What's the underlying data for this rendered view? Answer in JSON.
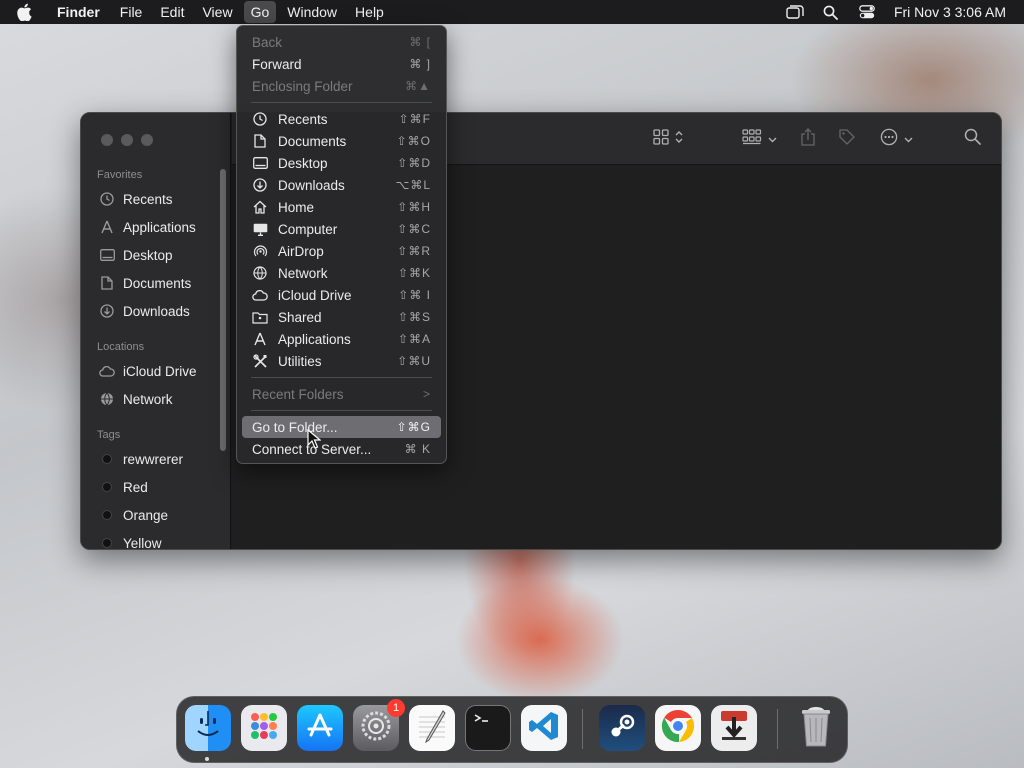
{
  "menubar": {
    "app_name": "Finder",
    "menus": [
      "File",
      "Edit",
      "View",
      "Go",
      "Window",
      "Help"
    ],
    "active_menu": "Go",
    "clock": "Fri Nov 3  3:06 AM"
  },
  "go_menu": {
    "items": [
      {
        "label": "Back",
        "shortcut": "⌘ [",
        "icon": "",
        "disabled": true
      },
      {
        "label": "Forward",
        "shortcut": "⌘ ]",
        "icon": "",
        "disabled": false
      },
      {
        "label": "Enclosing Folder",
        "shortcut": "⌘▲",
        "icon": "",
        "disabled": true
      },
      {
        "label": "Recents",
        "shortcut": "⇧⌘F",
        "icon": "clock-icon",
        "disabled": false
      },
      {
        "label": "Documents",
        "shortcut": "⇧⌘O",
        "icon": "document-icon",
        "disabled": false
      },
      {
        "label": "Desktop",
        "shortcut": "⇧⌘D",
        "icon": "desktop-icon",
        "disabled": false
      },
      {
        "label": "Downloads",
        "shortcut": "⌥⌘L",
        "icon": "download-icon",
        "disabled": false
      },
      {
        "label": "Home",
        "shortcut": "⇧⌘H",
        "icon": "home-icon",
        "disabled": false
      },
      {
        "label": "Computer",
        "shortcut": "⇧⌘C",
        "icon": "computer-icon",
        "disabled": false
      },
      {
        "label": "AirDrop",
        "shortcut": "⇧⌘R",
        "icon": "airdrop-icon",
        "disabled": false
      },
      {
        "label": "Network",
        "shortcut": "⇧⌘K",
        "icon": "globe-icon",
        "disabled": false
      },
      {
        "label": "iCloud Drive",
        "shortcut": "⇧⌘ I",
        "icon": "cloud-icon",
        "disabled": false
      },
      {
        "label": "Shared",
        "shortcut": "⇧⌘S",
        "icon": "shared-folder-icon",
        "disabled": false
      },
      {
        "label": "Applications",
        "shortcut": "⇧⌘A",
        "icon": "applications-icon",
        "disabled": false
      },
      {
        "label": "Utilities",
        "shortcut": "⇧⌘U",
        "icon": "tools-icon",
        "disabled": false
      },
      {
        "label": "Recent Folders",
        "shortcut": ">",
        "icon": "",
        "disabled": true
      },
      {
        "label": "Go to Folder...",
        "shortcut": "⇧⌘G",
        "icon": "",
        "disabled": false,
        "highlighted": true
      },
      {
        "label": "Connect to Server...",
        "shortcut": "⌘ K",
        "icon": "",
        "disabled": false
      }
    ]
  },
  "sidebar": {
    "favorites_title": "Favorites",
    "favorites": [
      {
        "label": "Recents",
        "icon": "clock-icon"
      },
      {
        "label": "Applications",
        "icon": "applications-icon"
      },
      {
        "label": "Desktop",
        "icon": "desktop-icon"
      },
      {
        "label": "Documents",
        "icon": "document-icon"
      },
      {
        "label": "Downloads",
        "icon": "download-icon"
      }
    ],
    "locations_title": "Locations",
    "locations": [
      {
        "label": "iCloud Drive",
        "icon": "cloud-icon"
      },
      {
        "label": "Network",
        "icon": "globe-icon"
      }
    ],
    "tags_title": "Tags",
    "tags": [
      "rewwrerer",
      "Red",
      "Orange",
      "Yellow"
    ]
  },
  "dock": {
    "apps": [
      "Finder",
      "Launchpad",
      "App Store",
      "System Settings",
      "TextEdit",
      "Terminal",
      "Visual Studio Code",
      "Steam",
      "Google Chrome",
      "Transmit",
      "Trash"
    ],
    "settings_badge": "1"
  }
}
